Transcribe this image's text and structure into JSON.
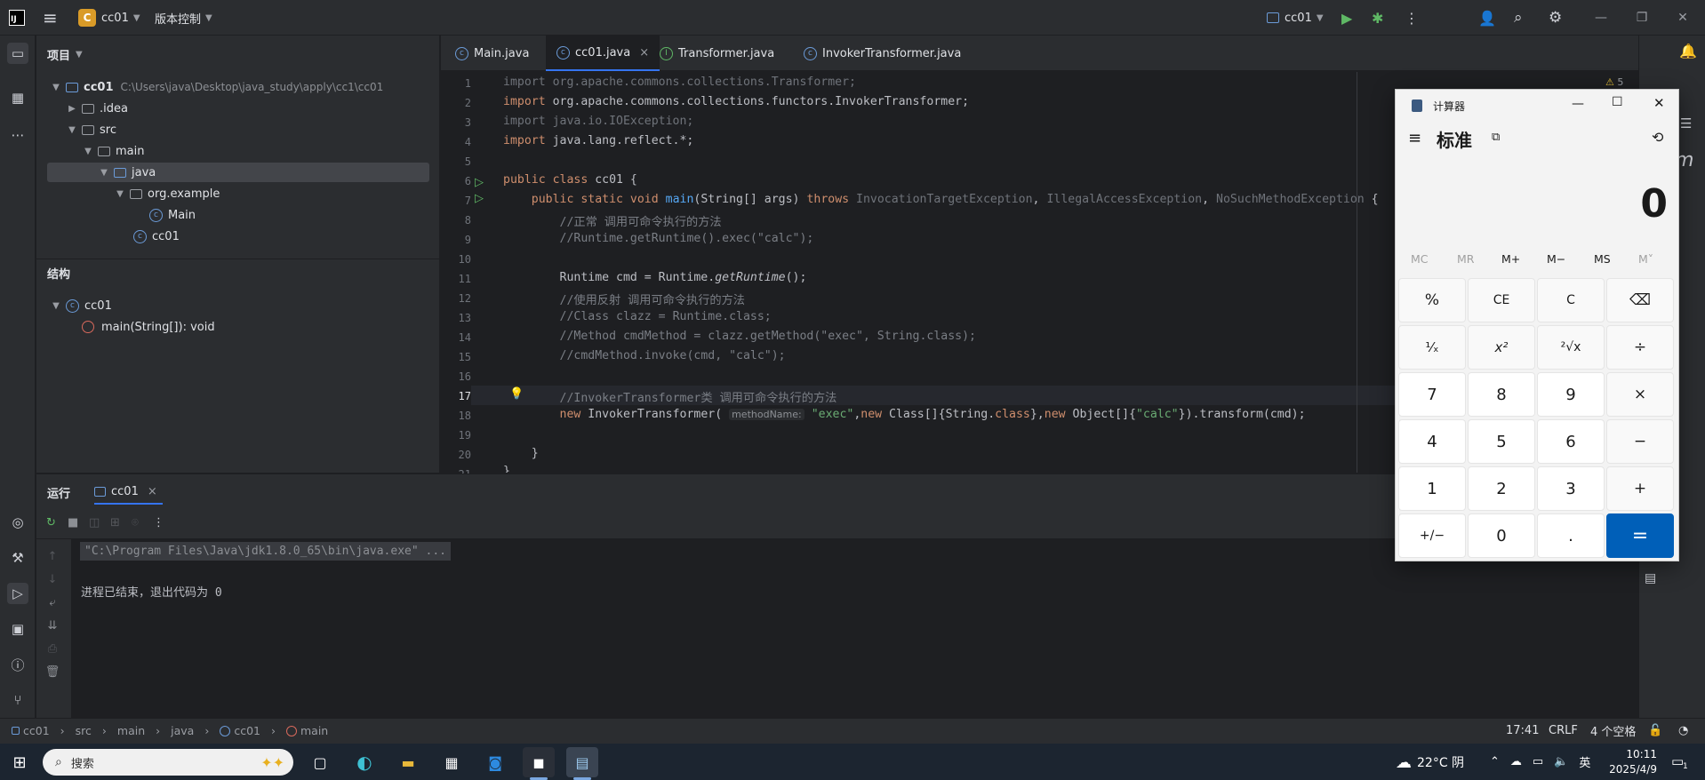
{
  "titlebar": {
    "project_badge": "C",
    "project_name": "cc01",
    "vcs_label": "版本控制",
    "run_config": "cc01",
    "icons": [
      "menu-icon",
      "run-icon",
      "debug-icon",
      "more-icon",
      "add-user-icon",
      "search-icon",
      "settings-icon",
      "minimize-icon",
      "maximize-icon",
      "close-icon"
    ]
  },
  "project_panel": {
    "title": "项目",
    "root_name": "cc01",
    "root_path": "C:\\Users\\java\\Desktop\\java_study\\apply\\cc1\\cc01",
    "items": [
      {
        "label": ".idea"
      },
      {
        "label": "src"
      },
      {
        "label": "main"
      },
      {
        "label": "java"
      },
      {
        "label": "org.example"
      },
      {
        "label": "Main"
      },
      {
        "label": "cc01"
      }
    ]
  },
  "structure_panel": {
    "title": "结构",
    "class_name": "cc01",
    "method": "main(String[]): void"
  },
  "tabs": [
    {
      "label": "Main.java"
    },
    {
      "label": "cc01.java",
      "close": "×"
    },
    {
      "label": "Transformer.java"
    },
    {
      "label": "InvokerTransformer.java"
    }
  ],
  "editor": {
    "warnings_count": "5",
    "line_numbers": [
      "1",
      "2",
      "3",
      "4",
      "5",
      "6",
      "7",
      "8",
      "9",
      "10",
      "11",
      "12",
      "13",
      "14",
      "15",
      "16",
      "17",
      "18",
      "19",
      "20",
      "21"
    ],
    "parameter_hint": "methodName:"
  },
  "run_panel": {
    "title": "运行",
    "tab_label": "cc01",
    "tab_close": "×",
    "command_line": "\"C:\\Program Files\\Java\\jdk1.8.0_65\\bin\\java.exe\" ...",
    "exit_message": "进程已结束，退出代码为 0"
  },
  "statusbar": {
    "breadcrumb": [
      "cc01",
      "src",
      "main",
      "java",
      "cc01",
      "main"
    ],
    "position": "17:41",
    "line_ending": "CRLF",
    "indent": "4 个空格"
  },
  "calculator": {
    "title": "计算器",
    "mode": "标准",
    "display": "0",
    "memory_buttons": [
      "MC",
      "MR",
      "M+",
      "M−",
      "MS",
      "M˅"
    ],
    "keys": [
      [
        "%",
        "CE",
        "C",
        "⌫"
      ],
      [
        "¹⁄ₓ",
        "x²",
        "²√x",
        "÷"
      ],
      [
        "7",
        "8",
        "9",
        "×"
      ],
      [
        "4",
        "5",
        "6",
        "−"
      ],
      [
        "1",
        "2",
        "3",
        "+"
      ],
      [
        "+/−",
        "0",
        ".",
        "="
      ]
    ]
  },
  "taskbar": {
    "search_placeholder": "搜索",
    "weather": "22°C 阴",
    "language": "英",
    "time": "10:11",
    "date": "2025/4/9",
    "notification_badge": "1"
  }
}
